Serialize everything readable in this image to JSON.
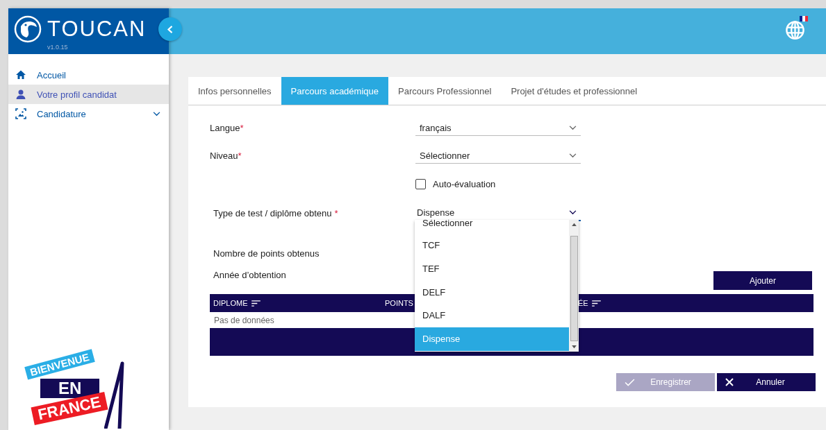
{
  "sidebar": {
    "logo": "TOUCAN",
    "version": "v1.0.15",
    "items": [
      {
        "label": "Accueil",
        "selected": false
      },
      {
        "label": "Votre profil candidat",
        "selected": true
      },
      {
        "label": "Candidature",
        "selected": false,
        "expandable": true
      }
    ],
    "promo": [
      "BIENVENUE",
      "EN",
      "FRANCE"
    ]
  },
  "tabs": [
    {
      "label": "Infos personnelles",
      "selected": false
    },
    {
      "label": "Parcours académique",
      "selected": true
    },
    {
      "label": "Parcours Professionnel",
      "selected": false
    },
    {
      "label": "Projet d'études et professionnel",
      "selected": false
    }
  ],
  "fields": [
    {
      "kind": "select",
      "label": "Langue",
      "mark": "*",
      "value": "français"
    },
    {
      "kind": "select",
      "label": "Niveau",
      "mark": "*",
      "value": "Sélectionner"
    },
    {
      "kind": "checkbox",
      "label": "Auto-évaluation",
      "checked": false
    },
    {
      "kind": "select",
      "label": "Type de test / diplôme obtenu",
      "mark": "*",
      "value": "Dispense",
      "open": true,
      "options": [
        {
          "label": "Sélectionner",
          "selected": false
        },
        {
          "label": "TCF",
          "selected": false
        },
        {
          "label": "TEF",
          "selected": false
        },
        {
          "label": "DELF",
          "selected": false
        },
        {
          "label": "DALF",
          "selected": false
        },
        {
          "label": "Dispense",
          "selected": true
        }
      ]
    },
    {
      "kind": "text",
      "label": "Nombre de points obtenus"
    },
    {
      "kind": "text",
      "label": "Année d’obtention"
    }
  ],
  "add_button": "Ajouter",
  "table": {
    "columns": [
      "DIPLOME",
      "POINTS",
      "ÉE"
    ],
    "empty": "Pas de données"
  },
  "buttons": [
    {
      "kind": "save",
      "label": "Enregistrer",
      "disabled": true
    },
    {
      "kind": "cancel",
      "label": "Annuler",
      "disabled": false
    }
  ]
}
